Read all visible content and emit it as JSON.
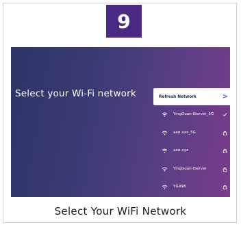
{
  "step": {
    "number": "9"
  },
  "screen": {
    "title": "Select your Wi-Fi network",
    "refresh": {
      "label": "Refresh Network",
      "chevron": ">"
    },
    "networks": [
      {
        "name": "YingGuan-iServer_5G",
        "status": "connected-check-icon"
      },
      {
        "name": "aao-xxx_5G",
        "status": "lock-icon"
      },
      {
        "name": "aao-xyz",
        "status": "lock-icon"
      },
      {
        "name": "YingGuan-iServer",
        "status": "lock-icon"
      },
      {
        "name": "YG998",
        "status": "lock-icon"
      }
    ]
  },
  "caption": "Select Your WiFi Network",
  "colors": {
    "badge": "#4b2a86",
    "screen_gradient_start": "#2d3566",
    "screen_gradient_end": "#7a3c8c",
    "refresh_chevron": "#4a5fc8"
  }
}
